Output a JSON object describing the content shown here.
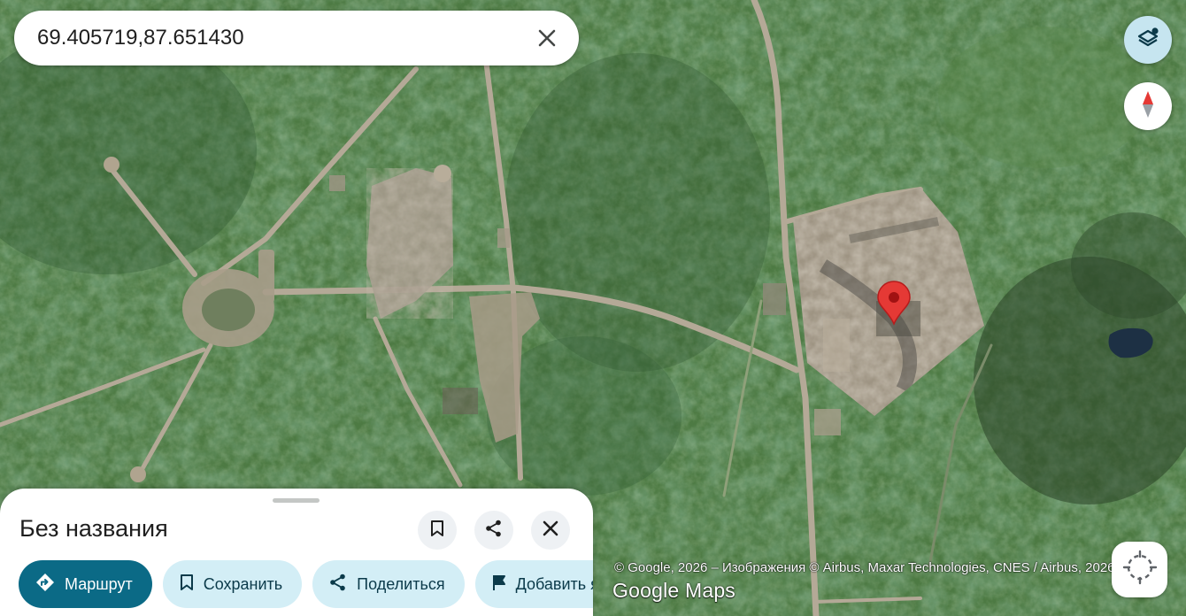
{
  "search": {
    "query": "69.405719,87.651430"
  },
  "icons": {
    "clear": "close-icon",
    "layers": "layers-icon",
    "compass": "compass-icon",
    "locate": "my-location-icon",
    "pin": "map-pin-icon"
  },
  "attribution": "© Google, 2026 – Изображения © Airbus, Maxar Technologies, CNES / Airbus, 2026",
  "watermark": {
    "brand": "Google",
    "product": "Maps"
  },
  "sheet": {
    "title": "Без названия",
    "chips": [
      {
        "label": "Маршрут",
        "icon": "directions-icon"
      },
      {
        "label": "Сохранить",
        "icon": "bookmark-icon"
      },
      {
        "label": "Поделиться",
        "icon": "share-icon"
      },
      {
        "label": "Добавить ярлык",
        "icon": "flag-icon"
      }
    ]
  },
  "colors": {
    "primary_chip": "#0b6a86",
    "secondary_chip": "#d3eef6",
    "layers_button": "#c6e5f0",
    "pin": "#e53935"
  }
}
